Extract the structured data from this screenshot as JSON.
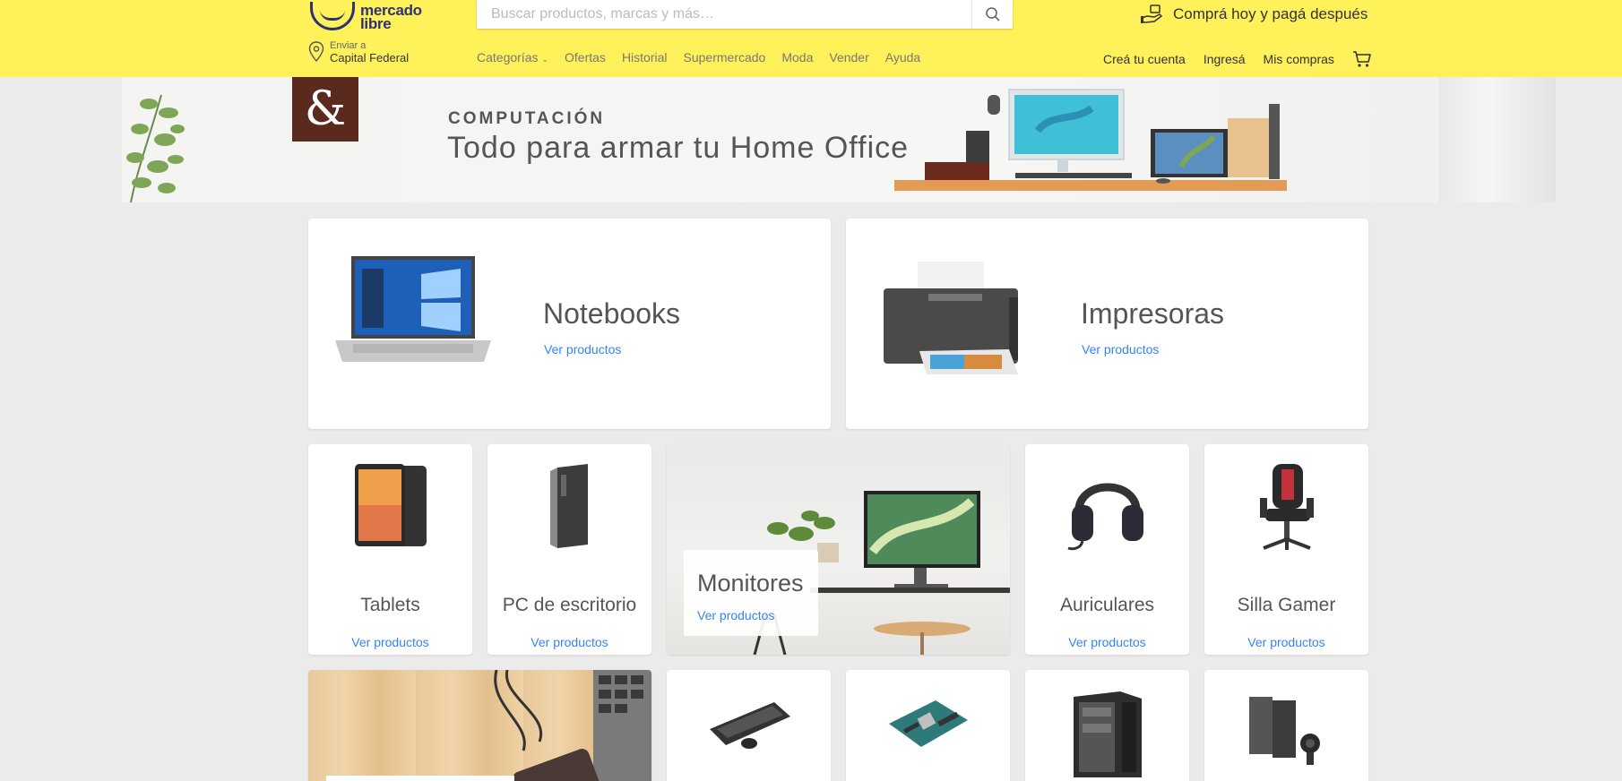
{
  "header": {
    "logo_line1": "mercado",
    "logo_line2": "libre",
    "search_placeholder": "Buscar productos, marcas y más…",
    "promo_text": "Comprá hoy y pagá después",
    "location_small": "Enviar a",
    "location_big": "Capital Federal",
    "nav": [
      {
        "label": "Categorías"
      },
      {
        "label": "Ofertas"
      },
      {
        "label": "Historial"
      },
      {
        "label": "Supermercado"
      },
      {
        "label": "Moda"
      },
      {
        "label": "Vender"
      },
      {
        "label": "Ayuda"
      }
    ],
    "user_nav": [
      {
        "label": "Creá tu cuenta"
      },
      {
        "label": "Ingresá"
      },
      {
        "label": "Mis compras"
      }
    ],
    "colors": {
      "header_bg": "#fff159",
      "logo": "#2d3277",
      "link": "#3483fa"
    }
  },
  "banner": {
    "eyebrow": "COMPUTACIÓN",
    "title": "Todo para armar tu Home Office",
    "amp": "&"
  },
  "categories_large": [
    {
      "title": "Notebooks",
      "link": "Ver productos"
    },
    {
      "title": "Impresoras",
      "link": "Ver productos"
    }
  ],
  "categories_small": [
    {
      "title": "Tablets",
      "link": "Ver productos"
    },
    {
      "title": "PC de escritorio",
      "link": "Ver productos"
    },
    {
      "title": "Monitores",
      "link": "Ver productos"
    },
    {
      "title": "Auriculares",
      "link": "Ver productos"
    },
    {
      "title": "Silla Gamer",
      "link": "Ver productos"
    }
  ]
}
